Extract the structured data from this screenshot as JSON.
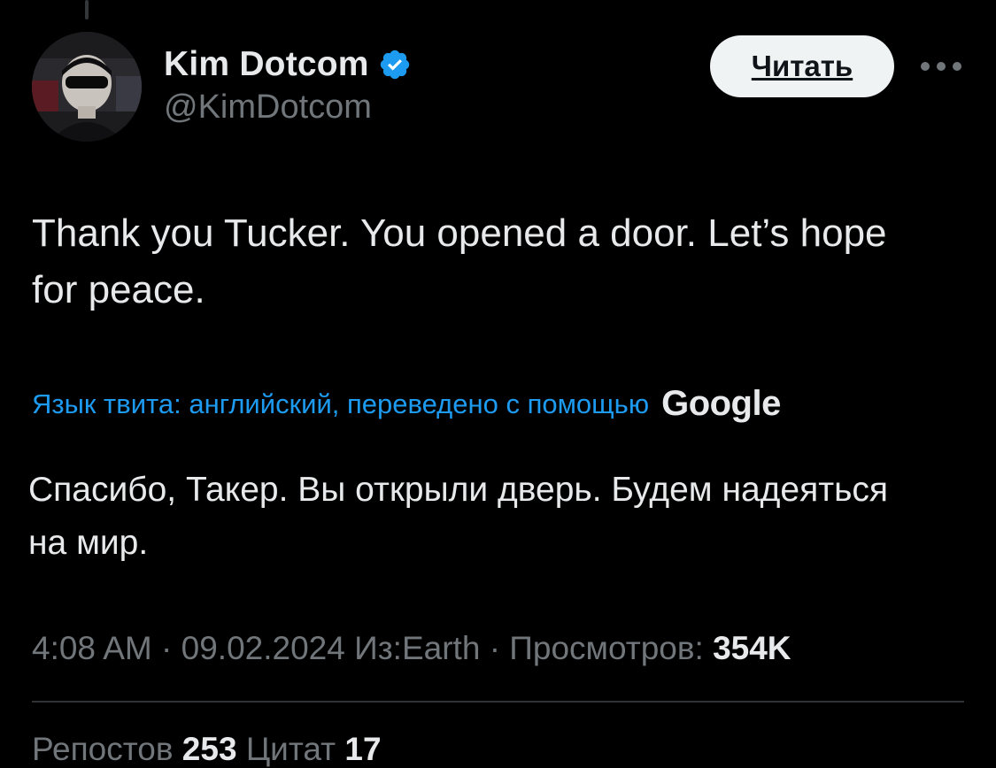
{
  "author": {
    "display_name": "Kim Dotcom",
    "handle": "@KimDotcom",
    "verified": true
  },
  "follow_button_label": "Читать",
  "tweet": {
    "text": "Thank you Tucker. You opened a door. Let’s hope for peace."
  },
  "translation": {
    "label": "Язык твита: английский, переведено с помощью",
    "provider": "Google",
    "text": "Спасибо, Такер. Вы открыли дверь. Будем надеяться на мир."
  },
  "meta": {
    "time": "4:08 AM",
    "date": "09.02.2024",
    "location": "Из:Earth",
    "views_label": "Просмотров:",
    "views_count": "354K"
  },
  "stats": {
    "reposts_label": "Репостов",
    "reposts_count": "253",
    "quotes_label": "Цитат",
    "quotes_count": "17"
  },
  "colors": {
    "background": "#000000",
    "text_primary": "#e7e9ea",
    "text_secondary": "#71767b",
    "link": "#1d9bf0",
    "verified_badge": "#1d9bf0"
  },
  "icons": {
    "verified": "verified-badge-icon",
    "more": "more-horizontal-icon"
  }
}
